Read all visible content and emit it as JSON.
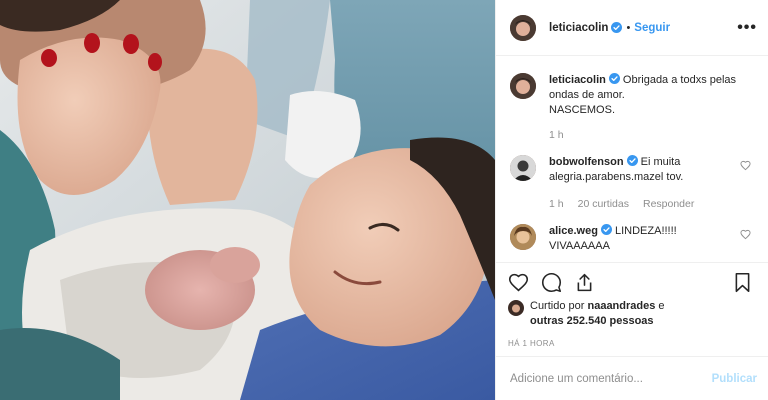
{
  "post": {
    "author": {
      "username": "leticiacolin",
      "verified": true,
      "follow_label": "Seguir",
      "more_label": "•••"
    },
    "photo_icon": "newborn-photo"
  },
  "comments": [
    {
      "username": "leticiacolin",
      "verified": true,
      "text_line1": "Obrigada a todxs pelas",
      "text_line2": "ondas de amor.",
      "text_line3": "NASCEMOS.",
      "time": "1 h"
    },
    {
      "username": "bobwolfenson",
      "verified": true,
      "text_line1": "Ei muita",
      "text_line2": "alegria.parabens.mazel tov.",
      "time": "1 h",
      "likes": "20 curtidas",
      "reply_label": "Responder"
    },
    {
      "username": "alice.weg",
      "verified": true,
      "text_line1": "LINDEZA!!!!!",
      "text_line2": "VIVAAAAAA"
    }
  ],
  "actions": {
    "like_icon": "heart-icon",
    "comment_icon": "comment-icon",
    "share_icon": "share-icon",
    "save_icon": "bookmark-icon"
  },
  "likes": {
    "prefix": "Curtido por",
    "user": "naaandrades",
    "conjunction": "e",
    "others": "outras 252.540 pessoas"
  },
  "timestamp": "HÁ 1 HORA",
  "add_comment": {
    "placeholder": "Adicione um comentário...",
    "publish_label": "Publicar"
  },
  "colors": {
    "link_blue": "#3897f0",
    "publish_disabled": "#b2dffc",
    "muted": "#8e8e8e",
    "verified_blue": "#3897f0"
  }
}
